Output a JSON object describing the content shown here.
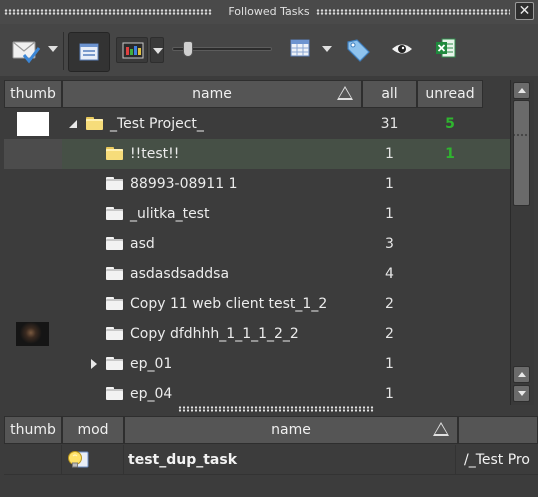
{
  "window": {
    "title": "Followed Tasks",
    "close_glyph": "✕"
  },
  "toolbar": {
    "icons": [
      "mail-check-icon",
      "view-panel-icon",
      "thumbnail-view-icon",
      "zoom-slider",
      "table-icon",
      "tag-icon",
      "eye-icon",
      "excel-export-icon"
    ],
    "zoom_level": 0.12
  },
  "tasks_table": {
    "columns": [
      "thumb",
      "name",
      "all",
      "unread"
    ],
    "sorted_column": "name",
    "rows": [
      {
        "name": "_Test Project_",
        "all": "31",
        "unread": "5",
        "folder": "yellow",
        "expander": "expanded",
        "indent": 0,
        "thumb": "white"
      },
      {
        "name": "!!test!!",
        "all": "1",
        "unread": "1",
        "folder": "yellow",
        "expander": "",
        "indent": 1,
        "selected": true
      },
      {
        "name": "88993-08911 1",
        "all": "1",
        "unread": "",
        "folder": "white",
        "expander": "",
        "indent": 1
      },
      {
        "name": "_ulitka_test",
        "all": "1",
        "unread": "",
        "folder": "white",
        "expander": "",
        "indent": 1
      },
      {
        "name": "asd",
        "all": "3",
        "unread": "",
        "folder": "white",
        "expander": "",
        "indent": 1
      },
      {
        "name": "asdasdsaddsa",
        "all": "4",
        "unread": "",
        "folder": "white",
        "expander": "",
        "indent": 1
      },
      {
        "name": "Copy 11 web client test_1_2",
        "all": "2",
        "unread": "",
        "folder": "white",
        "expander": "",
        "indent": 1
      },
      {
        "name": "Copy dfdhhh_1_1_1_2_2",
        "all": "2",
        "unread": "",
        "folder": "white",
        "expander": "",
        "indent": 1,
        "thumb": "image"
      },
      {
        "name": "ep_01",
        "all": "1",
        "unread": "",
        "folder": "white",
        "expander": "collapsed",
        "indent": 1
      },
      {
        "name": "ep_04",
        "all": "1",
        "unread": "",
        "folder": "white",
        "expander": "",
        "indent": 1
      }
    ]
  },
  "detail_table": {
    "columns": [
      "thumb",
      "mod",
      "name",
      ""
    ],
    "sorted_column": "name",
    "rows": [
      {
        "mod_icon": "lightbulb-icon",
        "name": "test_dup_task",
        "path": "/_Test Pro"
      }
    ]
  },
  "colors": {
    "unread": "#2fb52f",
    "selected_row": "#465046",
    "header": "#555555",
    "background": "#3c3c3c"
  }
}
